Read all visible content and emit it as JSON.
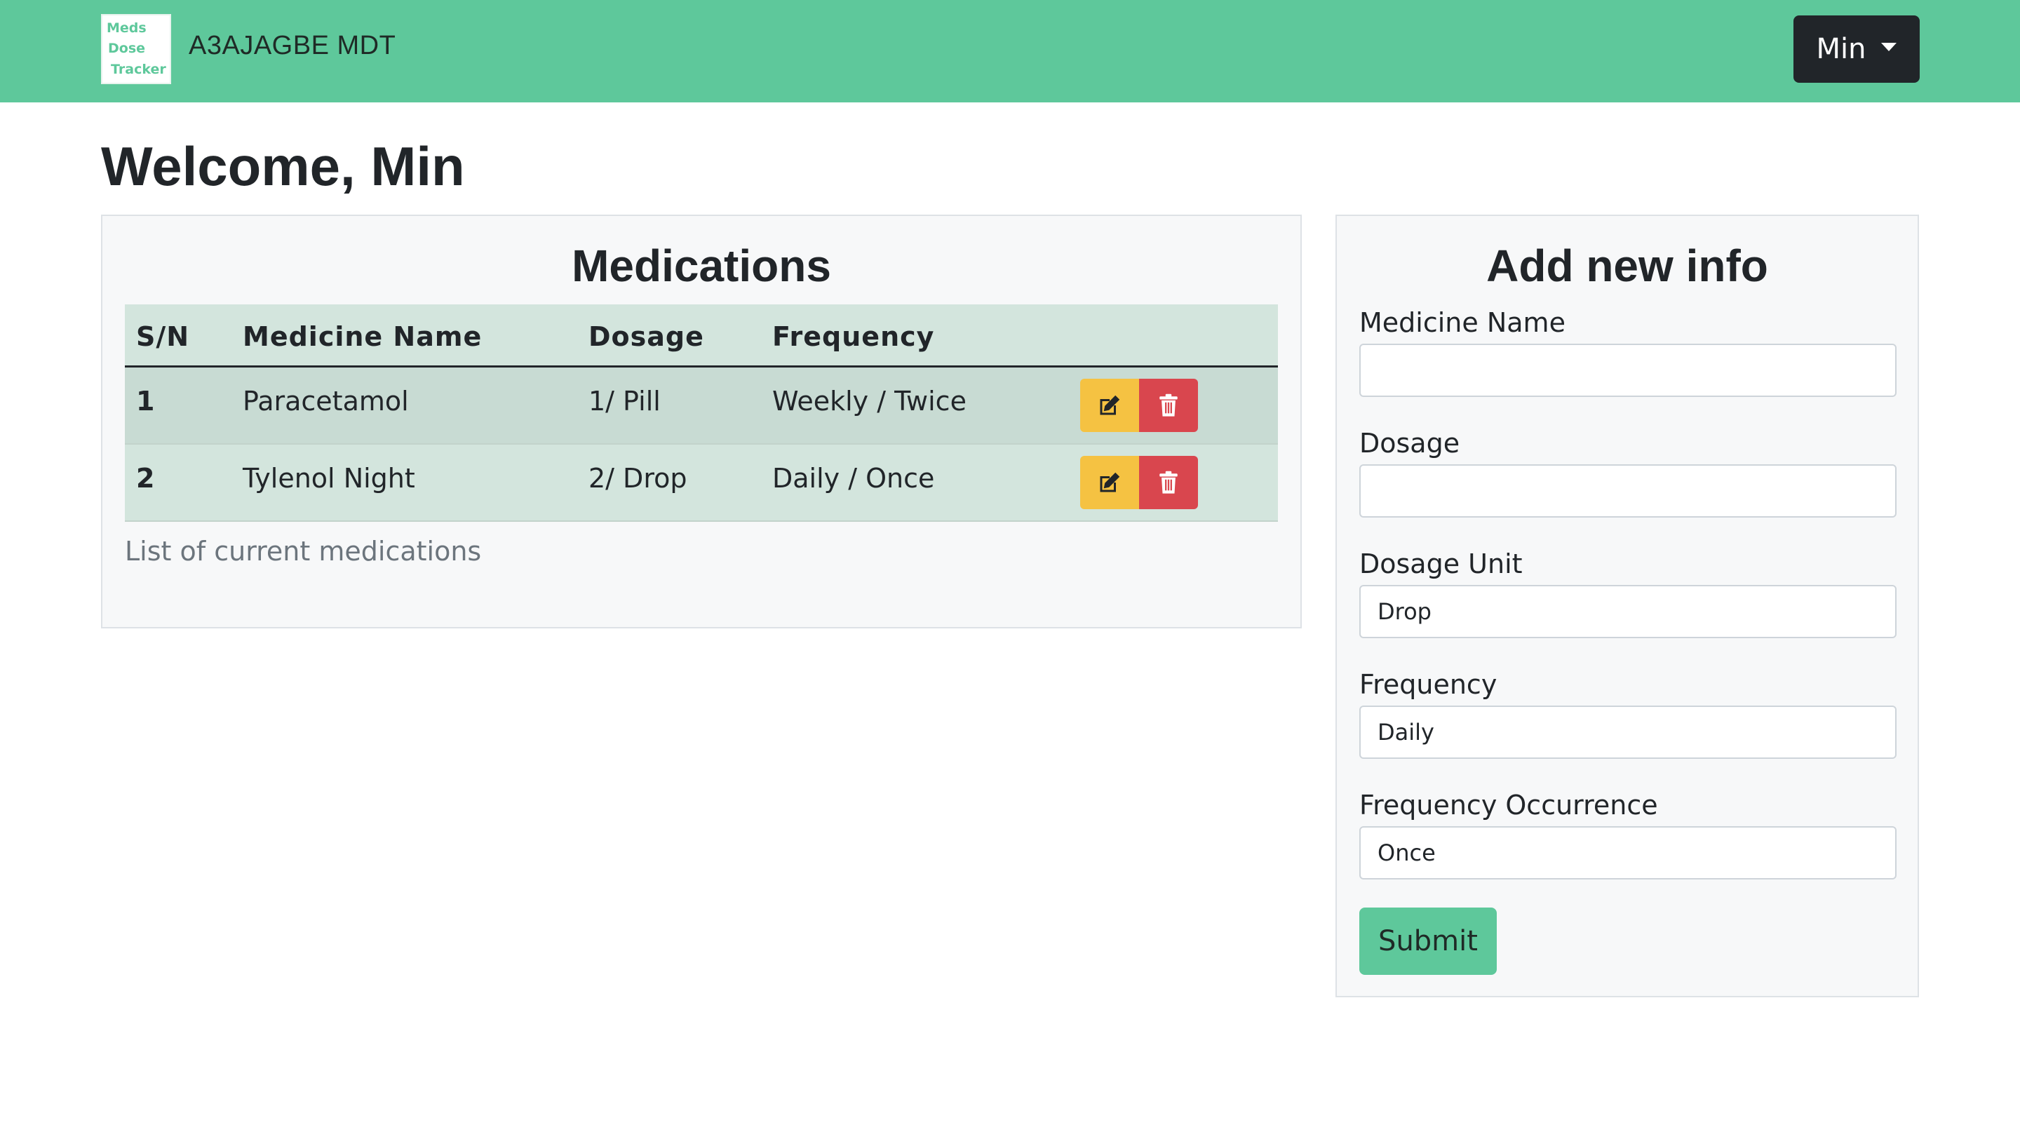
{
  "navbar": {
    "logo_lines": [
      "Meds",
      "Dose",
      "Tracker"
    ],
    "brand": "A3AJAGBE MDT",
    "user_menu": "Min"
  },
  "welcome": "Welcome, Min",
  "medications": {
    "title": "Medications",
    "columns": [
      "S/N",
      "Medicine Name",
      "Dosage",
      "Frequency"
    ],
    "rows": [
      {
        "sn": "1",
        "name": "Paracetamol",
        "dosage": "1/ Pill",
        "frequency": "Weekly / Twice"
      },
      {
        "sn": "2",
        "name": "Tylenol Night",
        "dosage": "2/ Drop",
        "frequency": "Daily / Once"
      }
    ],
    "caption": "List of current medications"
  },
  "form": {
    "title": "Add new info",
    "medicine_name_label": "Medicine Name",
    "medicine_name_value": "",
    "dosage_label": "Dosage",
    "dosage_value": "",
    "dosage_unit_label": "Dosage Unit",
    "dosage_unit_value": "Drop",
    "frequency_label": "Frequency",
    "frequency_value": "Daily",
    "frequency_occurrence_label": "Frequency Occurrence",
    "frequency_occurrence_value": "Once",
    "submit_label": "Submit"
  },
  "colors": {
    "brand_green": "#5ec89b",
    "dark": "#212529",
    "warning": "#f5c242",
    "danger": "#d9464e"
  },
  "icons": {
    "edit": "edit-icon",
    "delete": "trash-icon"
  }
}
